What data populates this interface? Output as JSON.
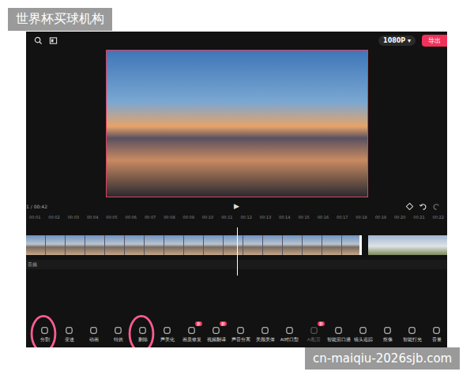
{
  "watermarks": {
    "top": "世界杯买球机构",
    "bottom": "cn-maiqiu-2026sjb.com"
  },
  "topbar": {
    "resolution": "1080P",
    "resolution_caret": "▾",
    "export": "导出"
  },
  "player": {
    "time": "1 / 00:42",
    "play": "▶",
    "playhead": 0.5
  },
  "ruler": [
    "00:01",
    "00:02",
    "00:03",
    "00:04",
    "00:05",
    "00:06",
    "00:07",
    "00:08",
    "00:09",
    "00:10",
    "00:11",
    "00:12",
    "00:13",
    "00:14",
    "00:15",
    "00:16",
    "00:17",
    "00:18",
    "00:19",
    "00:20",
    "00:21",
    "00:22"
  ],
  "tracks": {
    "audio_label": "音频"
  },
  "toolbar": [
    {
      "label": "分割",
      "badge": "",
      "disabled": false,
      "highlighted": true
    },
    {
      "label": "变速",
      "badge": "",
      "disabled": false,
      "highlighted": false
    },
    {
      "label": "动画",
      "badge": "",
      "disabled": false,
      "highlighted": false
    },
    {
      "label": "特效",
      "badge": "",
      "disabled": false,
      "highlighted": false
    },
    {
      "label": "删除",
      "badge": "",
      "disabled": false,
      "highlighted": true
    },
    {
      "label": "声美化",
      "badge": "",
      "disabled": false,
      "highlighted": false
    },
    {
      "label": "画质修复",
      "badge": "新",
      "disabled": false,
      "highlighted": false
    },
    {
      "label": "视频翻译",
      "badge": "新",
      "disabled": false,
      "highlighted": false
    },
    {
      "label": "声音分离",
      "badge": "",
      "disabled": false,
      "highlighted": false
    },
    {
      "label": "美颜美体",
      "badge": "",
      "disabled": false,
      "highlighted": false
    },
    {
      "label": "AI对口型",
      "badge": "",
      "disabled": false,
      "highlighted": false
    },
    {
      "label": "AI配音",
      "badge": "新",
      "disabled": true,
      "highlighted": false
    },
    {
      "label": "智能剪口播",
      "badge": "",
      "disabled": false,
      "highlighted": false
    },
    {
      "label": "镜头追踪",
      "badge": "",
      "disabled": false,
      "highlighted": false
    },
    {
      "label": "抠像",
      "badge": "",
      "disabled": false,
      "highlighted": false
    },
    {
      "label": "智能打光",
      "badge": "",
      "disabled": false,
      "highlighted": false
    },
    {
      "label": "音量",
      "badge": "",
      "disabled": false,
      "highlighted": false
    }
  ]
}
